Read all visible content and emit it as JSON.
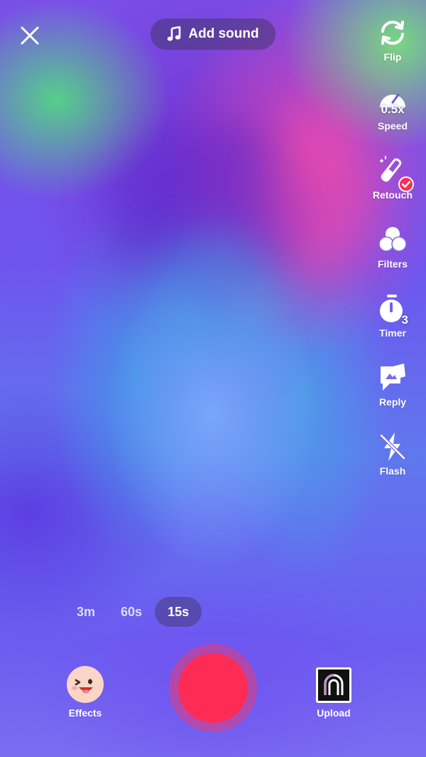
{
  "top": {
    "close_icon": "close-icon",
    "add_sound_label": "Add sound",
    "music_icon": "music-note-icon"
  },
  "tools": [
    {
      "id": "flip",
      "label": "Flip",
      "icon": "flip-icon"
    },
    {
      "id": "speed",
      "label": "Speed",
      "icon": "speed-gauge-icon",
      "value": "0.5x"
    },
    {
      "id": "retouch",
      "label": "Retouch",
      "icon": "wand-icon",
      "badge_color": "#fe2c55"
    },
    {
      "id": "filters",
      "label": "Filters",
      "icon": "filters-icon"
    },
    {
      "id": "timer",
      "label": "Timer",
      "icon": "stopwatch-icon",
      "value": "3"
    },
    {
      "id": "reply",
      "label": "Reply",
      "icon": "reply-icon"
    },
    {
      "id": "flash",
      "label": "Flash",
      "icon": "flash-off-icon"
    }
  ],
  "durations": {
    "options": [
      "3m",
      "60s",
      "15s"
    ],
    "selected": "15s"
  },
  "bottom": {
    "effects_label": "Effects",
    "upload_label": "Upload",
    "record_color": "#fe2c55"
  }
}
